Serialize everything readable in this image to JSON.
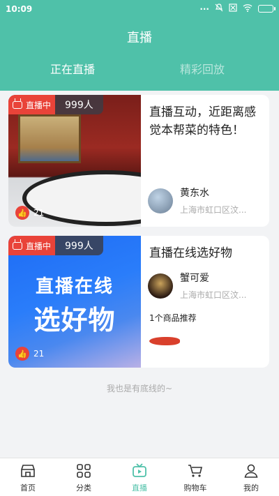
{
  "status": {
    "time": "10:09",
    "icons": [
      "dots-icon",
      "mute-icon",
      "sim-icon",
      "wifi-icon",
      "battery-icon"
    ]
  },
  "header": {
    "title": "直播"
  },
  "tabs": [
    {
      "label": "正在直播",
      "active": true
    },
    {
      "label": "精彩回放",
      "active": false
    }
  ],
  "cards": [
    {
      "live_label": "直播中",
      "viewers": "999人",
      "likes": "21",
      "title": "直播互动，近距离感觉本帮菜的特色！",
      "author": {
        "name": "黄东水",
        "location": "上海市虹口区汶..."
      }
    },
    {
      "live_label": "直播中",
      "viewers": "999人",
      "likes": "21",
      "banner_line1": "直播在线",
      "banner_line2": "选好物",
      "title": "直播在线选好物",
      "author": {
        "name": "蟹可爱",
        "location": "上海市虹口区汶..."
      },
      "products_label": "1个商品推荐"
    }
  ],
  "footer_note": "我也是有底线的~",
  "nav": [
    {
      "label": "首页",
      "icon": "home-icon",
      "active": false
    },
    {
      "label": "分类",
      "icon": "category-icon",
      "active": false
    },
    {
      "label": "直播",
      "icon": "live-tv-icon",
      "active": true
    },
    {
      "label": "购物车",
      "icon": "cart-icon",
      "active": false
    },
    {
      "label": "我的",
      "icon": "profile-icon",
      "active": false
    }
  ],
  "colors": {
    "accent": "#4fc1a9",
    "live_red": "#e94339"
  }
}
